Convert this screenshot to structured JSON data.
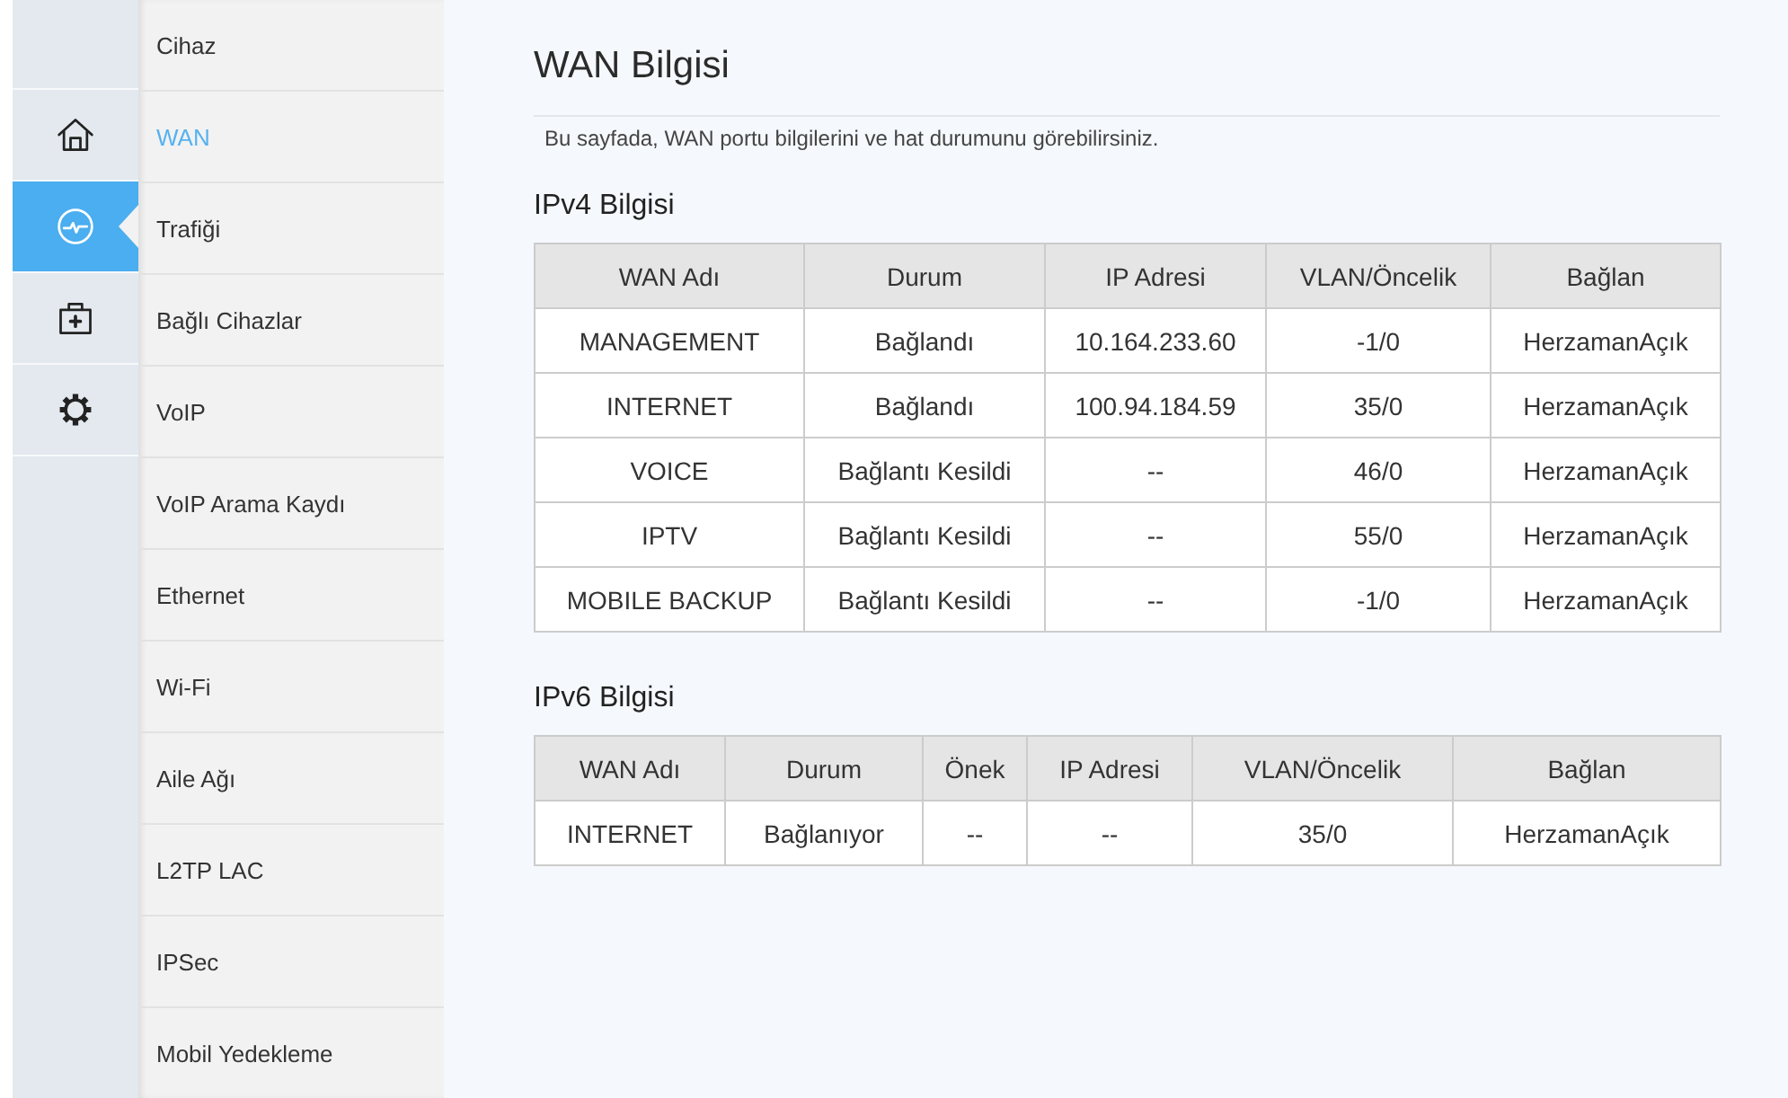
{
  "rail": {
    "items": [
      {
        "kind": "home",
        "selected": false
      },
      {
        "kind": "status",
        "selected": true
      },
      {
        "kind": "toolbox",
        "selected": false
      },
      {
        "kind": "settings",
        "selected": false
      }
    ]
  },
  "sidebar": {
    "items": [
      {
        "label": "Cihaz",
        "selected": false
      },
      {
        "label": "WAN",
        "selected": true
      },
      {
        "label": "Trafiği",
        "selected": false
      },
      {
        "label": "Bağlı Cihazlar",
        "selected": false
      },
      {
        "label": "VoIP",
        "selected": false
      },
      {
        "label": "VoIP Arama Kaydı",
        "selected": false
      },
      {
        "label": "Ethernet",
        "selected": false
      },
      {
        "label": "Wi-Fi",
        "selected": false
      },
      {
        "label": "Aile Ağı",
        "selected": false
      },
      {
        "label": "L2TP LAC",
        "selected": false
      },
      {
        "label": "IPSec",
        "selected": false
      },
      {
        "label": "Mobil Yedekleme",
        "selected": false
      }
    ]
  },
  "page": {
    "title": "WAN Bilgisi",
    "description": "Bu sayfada, WAN portu bilgilerini ve hat durumunu görebilirsiniz."
  },
  "ipv4": {
    "heading": "IPv4 Bilgisi",
    "columns": [
      "WAN Adı",
      "Durum",
      "IP Adresi",
      "VLAN/Öncelik",
      "Bağlan"
    ],
    "rows": [
      [
        "MANAGEMENT",
        "Bağlandı",
        "10.164.233.60",
        "-1/0",
        "HerzamanAçık"
      ],
      [
        "INTERNET",
        "Bağlandı",
        "100.94.184.59",
        "35/0",
        "HerzamanAçık"
      ],
      [
        "VOICE",
        "Bağlantı Kesildi",
        "--",
        "46/0",
        "HerzamanAçık"
      ],
      [
        "IPTV",
        "Bağlantı Kesildi",
        "--",
        "55/0",
        "HerzamanAçık"
      ],
      [
        "MOBILE BACKUP",
        "Bağlantı Kesildi",
        "--",
        "-1/0",
        "HerzamanAçık"
      ]
    ]
  },
  "ipv6": {
    "heading": "IPv6 Bilgisi",
    "columns": [
      "WAN Adı",
      "Durum",
      "Önek",
      "IP Adresi",
      "VLAN/Öncelik",
      "Bağlan"
    ],
    "rows": [
      [
        "INTERNET",
        "Bağlanıyor",
        "--",
        "--",
        "35/0",
        "HerzamanAçık"
      ]
    ]
  }
}
